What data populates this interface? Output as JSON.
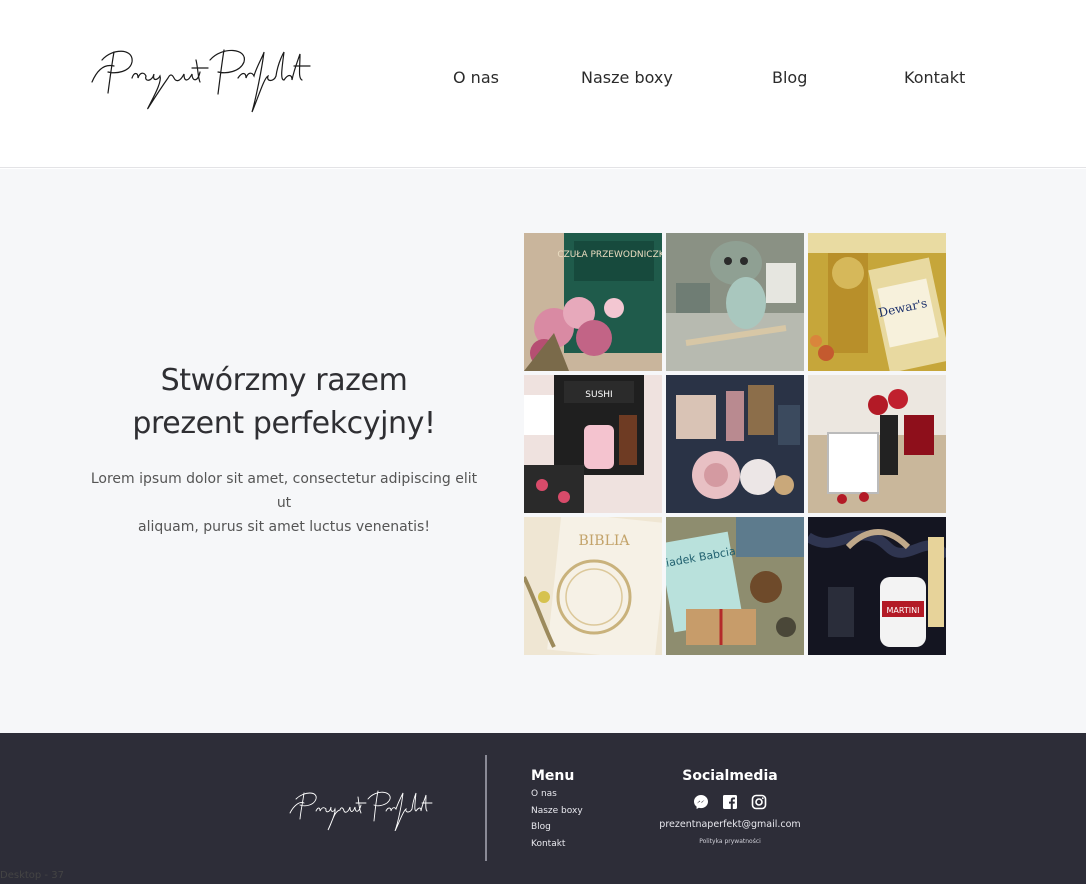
{
  "header": {
    "logo_text": "Prezent Perfekt",
    "nav": [
      {
        "label": "O nas"
      },
      {
        "label": "Nasze boxy"
      },
      {
        "label": "Blog"
      },
      {
        "label": "Kontakt"
      }
    ]
  },
  "hero": {
    "title_line1": "Stwórzmy razem",
    "title_line2": "prezent perfekcyjny!",
    "text_line1": "Lorem ipsum dolor sit amet, consectetur adipiscing elit ut",
    "text_line2": "aliquam, purus sit amet luctus venenatis!",
    "tiles": [
      {
        "name": "photo-book-flowers-box",
        "overlay": "CZUŁA PRZEWODNICZKA"
      },
      {
        "name": "photo-plush-toy-box"
      },
      {
        "name": "photo-dewars-gift-box",
        "overlay": "Dewar's"
      },
      {
        "name": "photo-sushi-box",
        "overlay": "SUSHI"
      },
      {
        "name": "photo-teddy-rose-box"
      },
      {
        "name": "photo-red-roses-frame-box"
      },
      {
        "name": "photo-bible-box",
        "overlay": "BIBLIA"
      },
      {
        "name": "photo-dziadek-babcia-box",
        "overlay": "Dziadek Babcia"
      },
      {
        "name": "photo-martini-box",
        "overlay": "MARTINI"
      }
    ]
  },
  "footer": {
    "logo_text": "Prezent Perfekt",
    "menu_title": "Menu",
    "menu": [
      "O nas",
      "Nasze boxy",
      "Blog",
      "Kontakt"
    ],
    "social_title": "Socialmedia",
    "social_icons": [
      "messenger-icon",
      "facebook-icon",
      "instagram-icon"
    ],
    "email": "prezentnaperfekt@gmail.com",
    "privacy": "Polityka prywatności"
  },
  "frame_label": "Desktop - 37"
}
